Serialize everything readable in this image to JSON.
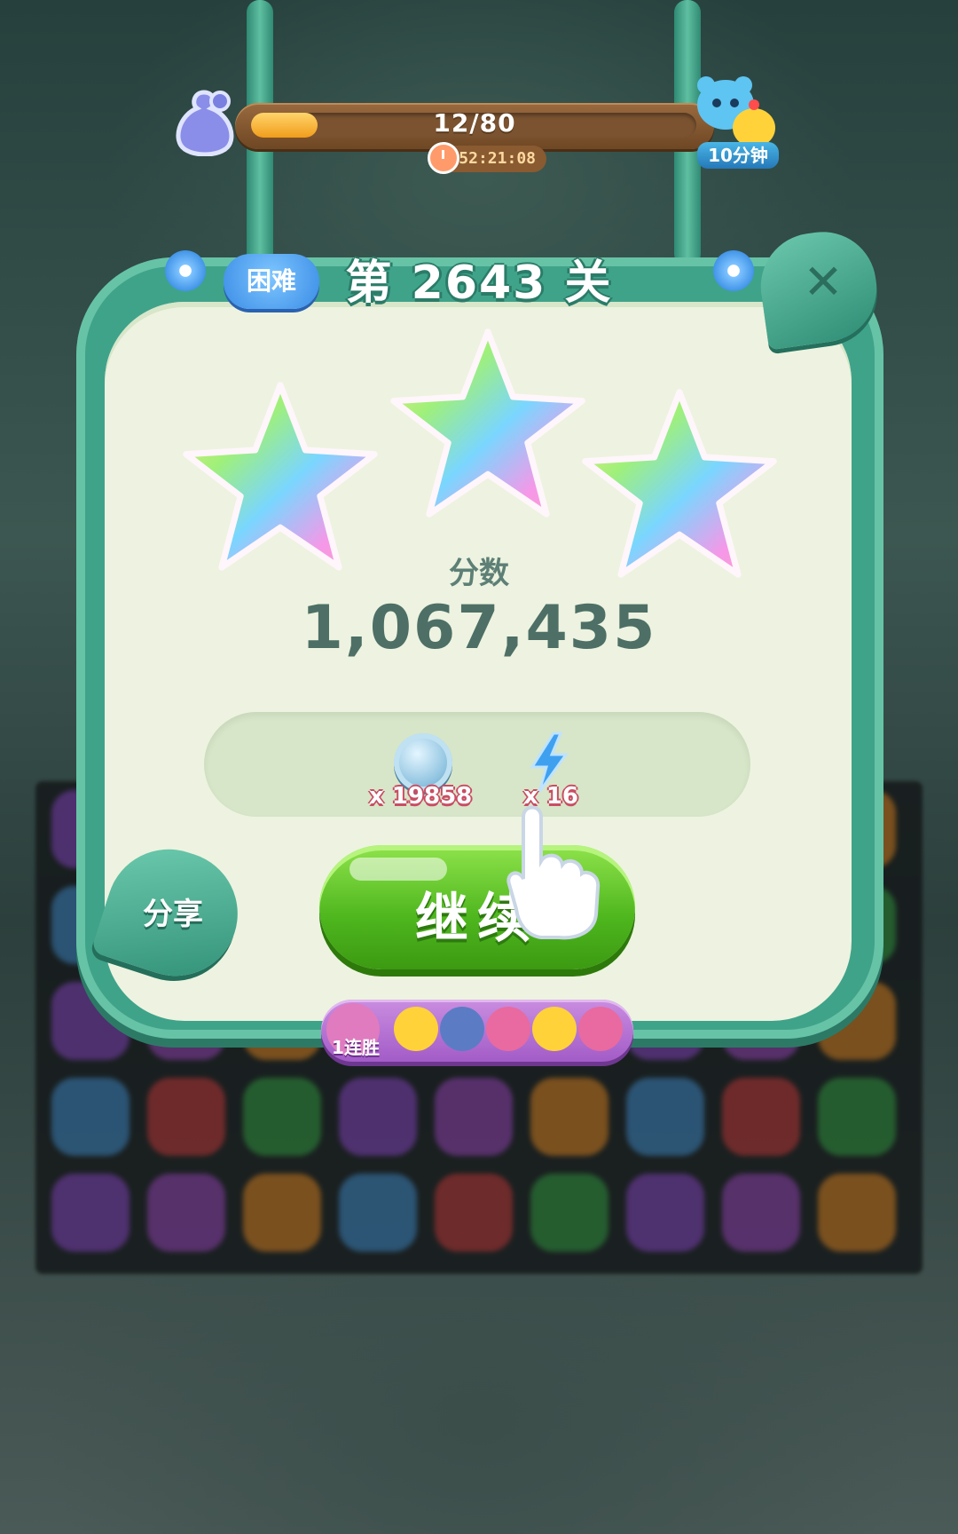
{
  "hud": {
    "progress_text": "12/80",
    "progress_fraction": 0.15,
    "timer": "52:21:08",
    "reward_label": "10分钟"
  },
  "dialog": {
    "difficulty": "困难",
    "title": "第 2643 关",
    "stars_earned": 3,
    "score_label": "分数",
    "score_value": "1,067,435",
    "rewards": [
      {
        "icon": "leaf-coin-icon",
        "count": "x 19858"
      },
      {
        "icon": "lightning-bolt-icon",
        "count": "x 16"
      }
    ],
    "continue_label": "继续",
    "share_label": "分享",
    "streak_label": "1连胜"
  }
}
